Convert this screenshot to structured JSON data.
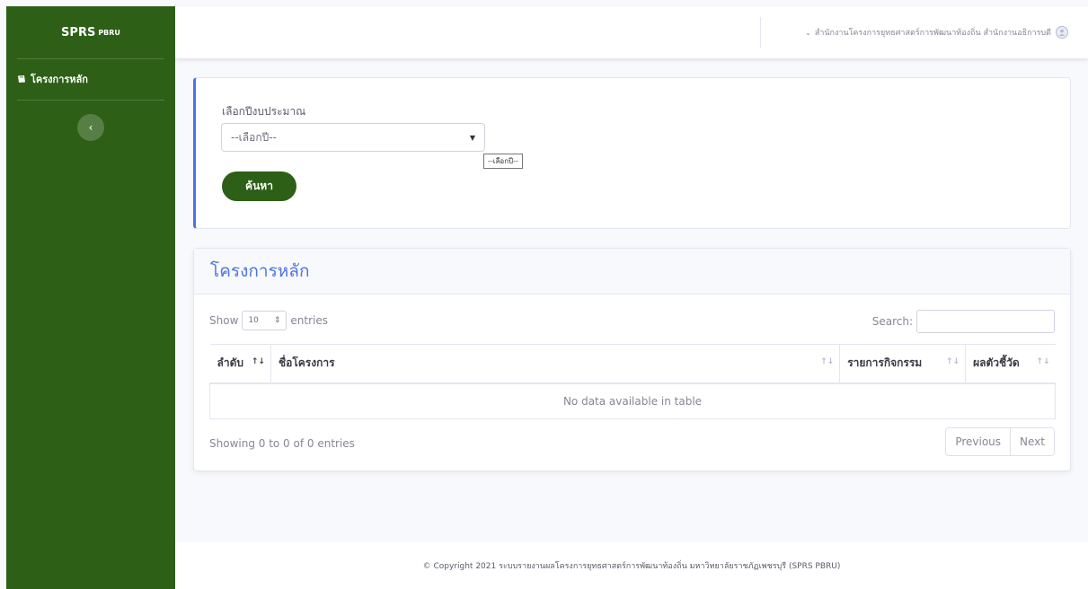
{
  "sidebar": {
    "brand": "SPRS",
    "brand_sup": "PBRU",
    "items": [
      {
        "label": "โครงการหลัก",
        "icon": "book-icon"
      }
    ],
    "toggle_icon": "chevron-left-icon"
  },
  "topbar": {
    "user_name": "สำนักงานโครงการยุทธศาสตร์การพัฒนาท้องถิ่น สำนักงานอธิการบดี",
    "caret": "⌄"
  },
  "filter": {
    "label": "เลือกปีงบประมาณ",
    "select_value": "--เลือกปี--",
    "tooltip": "--เลือกปี--",
    "search_button": "ค้นหา"
  },
  "table_card": {
    "title": "โครงการหลัก",
    "show_label": "Show",
    "entries_value": "10",
    "entries_label": "entries",
    "search_label": "Search:",
    "columns": [
      "ลำดับ",
      "ชื่อโครงการ",
      "รายการกิจกรรม",
      "ผลตัวชี้วัด"
    ],
    "empty_message": "No data available in table",
    "info": "Showing 0 to 0 of 0 entries",
    "prev_label": "Previous",
    "next_label": "Next"
  },
  "footer": {
    "text": "© Copyright 2021 ระบบรายงานผลโครงการยุทธศาสตร์การพัฒนาท้องถิ่น มหาวิทยาลัยราชภัฏเพชรบุรี (SPRS PBRU)"
  },
  "colors": {
    "sidebar": "#2d5f17",
    "accent": "#4e73df"
  }
}
